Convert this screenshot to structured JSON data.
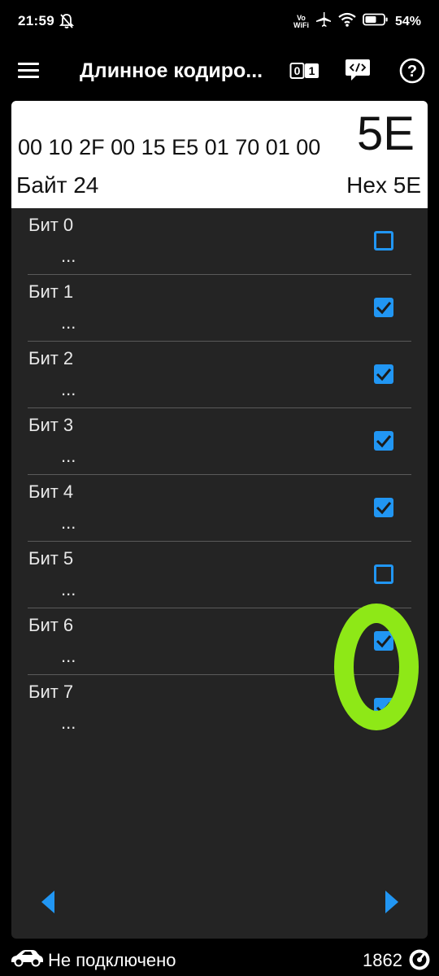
{
  "status_bar": {
    "time": "21:59",
    "vowifi_top": "Vo",
    "vowifi_bottom": "WiFi",
    "battery_percent": "54%",
    "icons": [
      "bell-muted-icon",
      "vowifi-icon",
      "airplane-icon",
      "wifi-icon",
      "battery-icon"
    ]
  },
  "app_bar": {
    "title": "Длинное кодиро...",
    "binary_toggle": {
      "left": "0",
      "right": "1"
    },
    "icons": [
      "menu-icon",
      "binary-toggle-icon",
      "code-icon",
      "help-icon"
    ],
    "help_glyph": "?"
  },
  "hex_header": {
    "stream": "00 10 2F 00 15 E5 01 70 01 00",
    "current_value": "5E",
    "byte_label": "Байт 24",
    "hex_label": "Hex 5E"
  },
  "bits": [
    {
      "name": "Бит 0",
      "desc": "...",
      "checked": false
    },
    {
      "name": "Бит 1",
      "desc": "...",
      "checked": true
    },
    {
      "name": "Бит 2",
      "desc": "...",
      "checked": true
    },
    {
      "name": "Бит 3",
      "desc": "...",
      "checked": true
    },
    {
      "name": "Бит 4",
      "desc": "...",
      "checked": true
    },
    {
      "name": "Бит 5",
      "desc": "...",
      "checked": false
    },
    {
      "name": "Бит 6",
      "desc": "...",
      "checked": true
    },
    {
      "name": "Бит 7",
      "desc": "...",
      "checked": true
    }
  ],
  "navigation": {
    "icons": [
      "prev-arrow-icon",
      "next-arrow-icon"
    ]
  },
  "footer": {
    "connection_status": "Не подключено",
    "counter": "1862",
    "icons": [
      "car-icon",
      "gauge-icon"
    ]
  },
  "overlay": {
    "glyph": "0",
    "color": "#8ee817"
  },
  "colors": {
    "accent": "#2196f3",
    "panel": "#242424",
    "background": "#000000",
    "header": "#ffffff"
  }
}
